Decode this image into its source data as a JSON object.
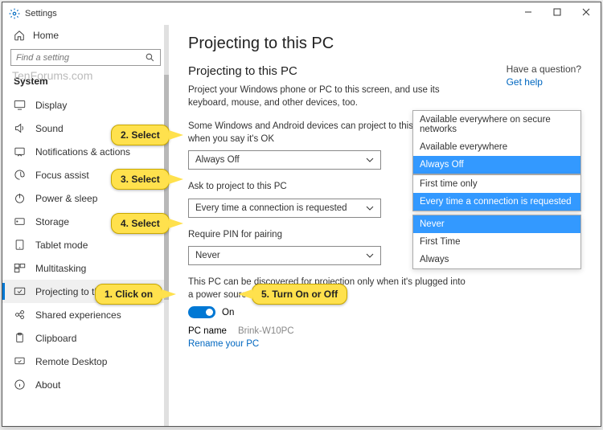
{
  "window": {
    "title": "Settings"
  },
  "watermark": "TenForums.com",
  "sidebar": {
    "home": "Home",
    "search_placeholder": "Find a setting",
    "section": "System",
    "items": [
      {
        "label": "Display"
      },
      {
        "label": "Sound"
      },
      {
        "label": "Notifications & actions"
      },
      {
        "label": "Focus assist"
      },
      {
        "label": "Power & sleep"
      },
      {
        "label": "Storage"
      },
      {
        "label": "Tablet mode"
      },
      {
        "label": "Multitasking"
      },
      {
        "label": "Projecting to this PC"
      },
      {
        "label": "Shared experiences"
      },
      {
        "label": "Clipboard"
      },
      {
        "label": "Remote Desktop"
      },
      {
        "label": "About"
      }
    ]
  },
  "main": {
    "title": "Projecting to this PC",
    "section_title": "Projecting to this PC",
    "desc": "Project your Windows phone or PC to this screen, and use its keyboard, mouse, and other devices, too.",
    "group1_label": "Some Windows and Android devices can project to this PC when you say it's OK",
    "group1_value": "Always Off",
    "group2_label": "Ask to project to this PC",
    "group2_value": "Every time a connection is requested",
    "group3_label": "Require PIN for pairing",
    "group3_value": "Never",
    "discover_text": "This PC can be discovered for projection only when it's plugged into a power source",
    "toggle_state": "On",
    "pc_label": "PC name",
    "pc_value": "Brink-W10PC",
    "rename_link": "Rename your PC"
  },
  "help": {
    "q": "Have a question?",
    "link": "Get help"
  },
  "popup1": {
    "opts": [
      "Available everywhere on secure networks",
      "Available everywhere",
      "Always Off"
    ],
    "sel": 2
  },
  "popup2": {
    "opts": [
      "First time only",
      "Every time a connection is requested"
    ],
    "sel": 1
  },
  "popup3": {
    "opts": [
      "Never",
      "First Time",
      "Always"
    ],
    "sel": 0
  },
  "callouts": {
    "c1": "1. Click on",
    "c2": "2. Select",
    "c3": "3. Select",
    "c4": "4. Select",
    "c5": "5. Turn On or Off"
  }
}
